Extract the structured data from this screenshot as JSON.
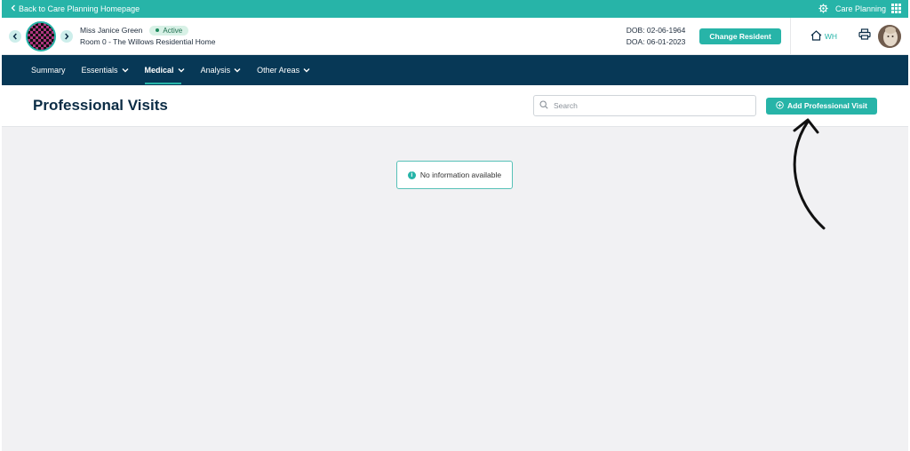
{
  "topbar": {
    "back_label": "Back to Care Planning Homepage",
    "app_label": "Care Planning"
  },
  "resident": {
    "name": "Miss Janice Green",
    "status": "Active",
    "room": "Room 0 - The Willows Residential Home",
    "dob": "DOB: 02-06-1964",
    "doa": "DOA: 06-01-2023",
    "change_label": "Change Resident",
    "home_code": "WH"
  },
  "nav": {
    "items": [
      {
        "label": "Summary"
      },
      {
        "label": "Essentials"
      },
      {
        "label": "Medical"
      },
      {
        "label": "Analysis"
      },
      {
        "label": "Other Areas"
      }
    ],
    "active": "Medical"
  },
  "page": {
    "title": "Professional Visits",
    "search_placeholder": "Search",
    "add_label": "Add Professional Visit"
  },
  "content": {
    "empty_message": "No information available"
  },
  "colors": {
    "accent": "#27b4a8",
    "nav_bg": "#073856",
    "content_bg": "#f1f1f3"
  },
  "icons": [
    "chevron-left-icon",
    "settings-icon",
    "grid-icon",
    "home-icon",
    "print-icon",
    "search-icon",
    "plus-circle-icon",
    "info-icon",
    "annotation-arrow"
  ]
}
